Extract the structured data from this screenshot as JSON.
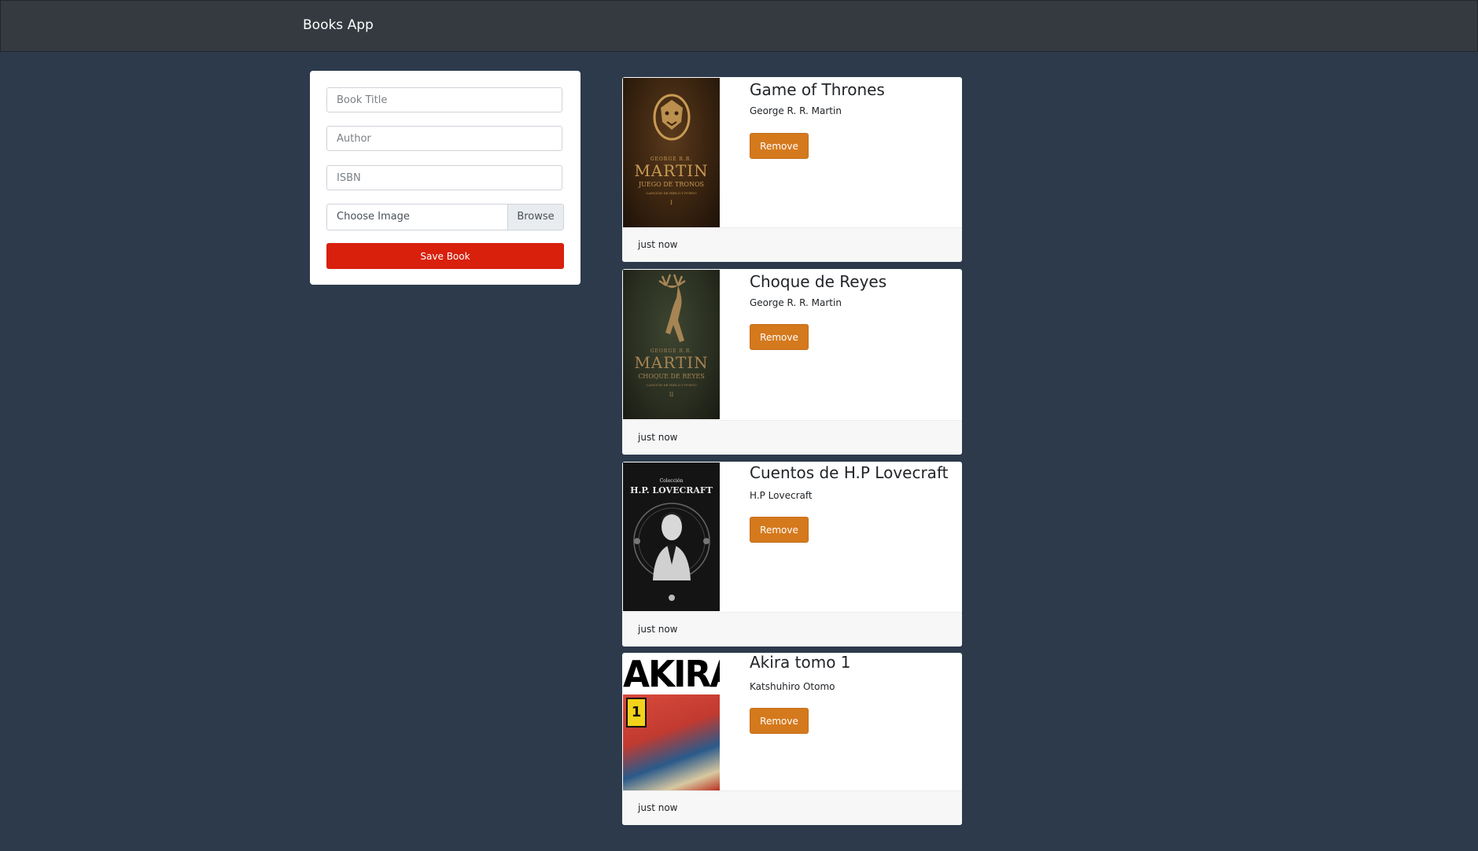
{
  "app": {
    "brand": "Books App"
  },
  "form": {
    "title_placeholder": "Book Title",
    "author_placeholder": "Author",
    "isbn_placeholder": "ISBN",
    "image_label": "Choose Image",
    "browse_label": "Browse",
    "save_label": "Save Book"
  },
  "books": [
    {
      "title": "Game of Thrones",
      "author": "George R. R. Martin",
      "remove_label": "Remove",
      "time": "just now",
      "cover": {
        "author_text": "GEORGE R.R.",
        "name_text": "MARTIN",
        "subtitle": "JUEGO DE TRONOS",
        "series": "CANCIÓN DE HIELO Y FUEGO",
        "volume": "I",
        "emblem": "lion-sigil"
      }
    },
    {
      "title": "Choque de Reyes",
      "author": "George R. R. Martin",
      "remove_label": "Remove",
      "time": "just now",
      "cover": {
        "author_text": "GEORGE R.R.",
        "name_text": "MARTIN",
        "subtitle": "CHOQUE DE REYES",
        "series": "CANCIÓN DE HIELO Y FUEGO",
        "volume": "II",
        "emblem": "stag-sigil"
      }
    },
    {
      "title": "Cuentos de H.P Lovecraft",
      "author": "H.P Lovecraft",
      "remove_label": "Remove",
      "time": "just now",
      "cover": {
        "top_text": "Colección",
        "name_text": "H.P. LOVECRAFT"
      }
    },
    {
      "title": "Akira tomo 1",
      "author": "Katshuhiro Otomo",
      "remove_label": "Remove",
      "time": "just now",
      "cover": {
        "name_text": "AKIRA",
        "volume": "1"
      }
    }
  ]
}
